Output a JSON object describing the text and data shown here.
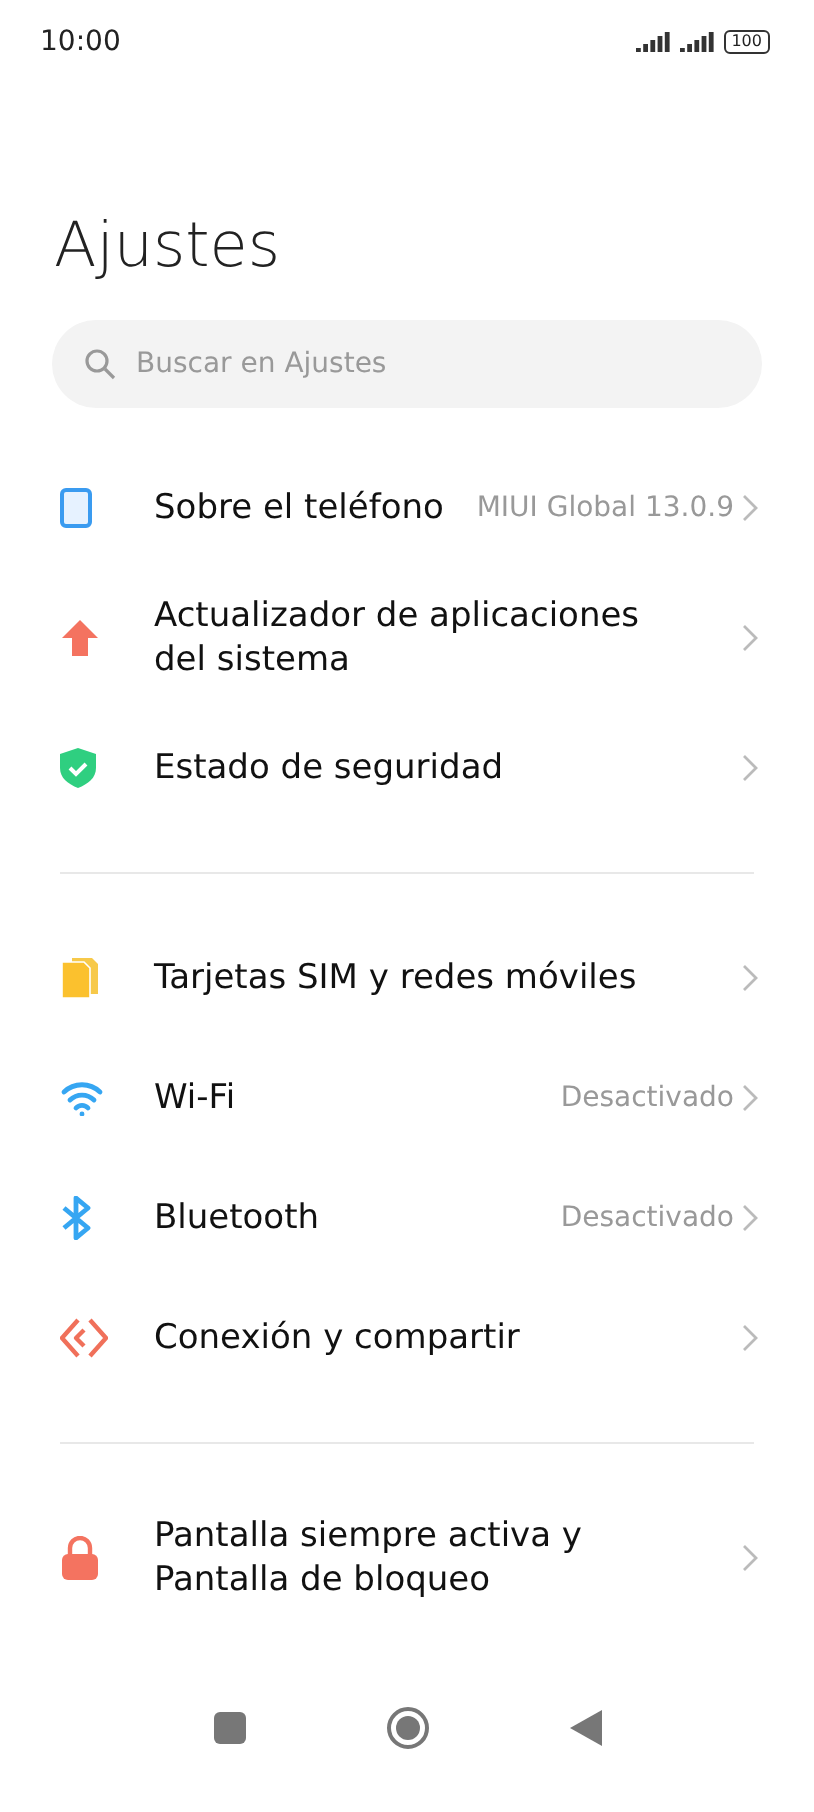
{
  "status_bar": {
    "time": "10:00",
    "battery": "100"
  },
  "title": "Ajustes",
  "search": {
    "placeholder": "Buscar en Ajustes"
  },
  "sections": [
    {
      "items": [
        {
          "label": "Sobre el teléfono",
          "value": "MIUI Global 13.0.9"
        },
        {
          "label": "Actualizador de aplicaciones del sistema"
        },
        {
          "label": "Estado de seguridad"
        }
      ]
    },
    {
      "items": [
        {
          "label": "Tarjetas SIM y redes móviles"
        },
        {
          "label": "Wi-Fi",
          "value": "Desactivado"
        },
        {
          "label": "Bluetooth",
          "value": "Desactivado"
        },
        {
          "label": "Conexión y compartir"
        }
      ]
    },
    {
      "items": [
        {
          "label": "Pantalla siempre activa y Pantalla de bloqueo"
        }
      ]
    }
  ]
}
